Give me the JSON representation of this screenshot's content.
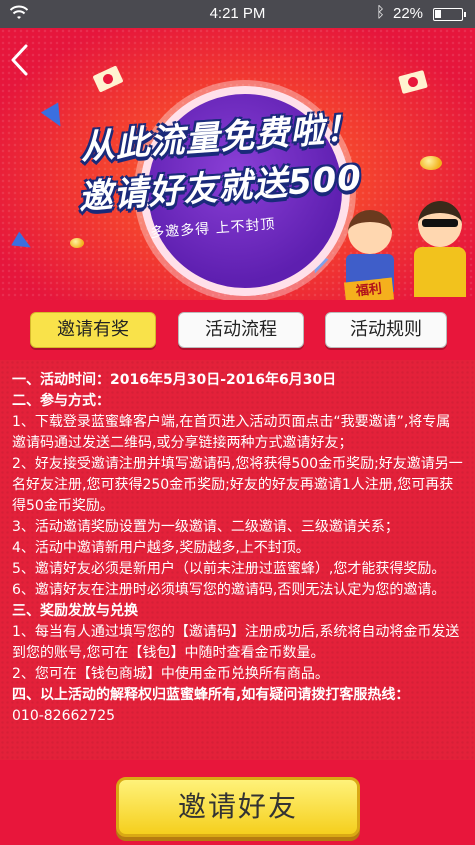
{
  "status_bar": {
    "time": "4:21 PM",
    "battery_text": "22%",
    "battery_level": 0.22,
    "wifi_icon": "wifi-icon",
    "bluetooth_icon": "bluetooth-icon"
  },
  "banner": {
    "back_icon": "chevron-left-icon",
    "headline_line1": "从此流量免费啦！",
    "headline_line2": "邀请好友就送500",
    "tagline": "多邀多得 上不封顶",
    "sign_text": "福利",
    "colors": {
      "background": "#e8163b",
      "circle": "#5e1fb0",
      "text_shadow": "#1a2a7a"
    }
  },
  "tabs": [
    {
      "label": "邀请有奖",
      "active": true
    },
    {
      "label": "活动流程",
      "active": false
    },
    {
      "label": "活动规则",
      "active": false
    }
  ],
  "content": {
    "lines": [
      {
        "text": "一、活动时间：2016年5月30日-2016年6月30日",
        "heading": true
      },
      {
        "text": "二、参与方式：",
        "heading": true
      },
      {
        "text": "1、下载登录蓝蜜蜂客户端,在首页进入活动页面点击“我要邀请”,将专属邀请码通过发送二维码,或分享链接两种方式邀请好友；",
        "heading": false
      },
      {
        "text": "2、好友接受邀请注册并填写邀请码,您将获得500金币奖励;好友邀请另一名好友注册,您可获得250金币奖励;好友的好友再邀请1人注册,您可再获得50金币奖励。",
        "heading": false
      },
      {
        "text": "3、活动邀请奖励设置为一级邀请、二级邀请、三级邀请关系；",
        "heading": false
      },
      {
        "text": "4、活动中邀请新用户越多,奖励越多,上不封顶。",
        "heading": false
      },
      {
        "text": "5、邀请好友必须是新用户（以前未注册过蓝蜜蜂）,您才能获得奖励。",
        "heading": false
      },
      {
        "text": "6、邀请好友在注册时必须填写您的邀请码,否则无法认定为您的邀请。",
        "heading": false
      },
      {
        "text": "三、奖励发放与兑换",
        "heading": true
      },
      {
        "text": "1、每当有人通过填写您的【邀请码】注册成功后,系统将自动将金币发送到您的账号,您可在【钱包】中随时查看金币数量。",
        "heading": false
      },
      {
        "text": "2、您可在【钱包商城】中使用金币兑换所有商品。",
        "heading": false
      },
      {
        "text": "四、以上活动的解释权归蓝蜜蜂所有,如有疑问请拨打客服热线：",
        "heading": true
      },
      {
        "text": "010-82662725",
        "heading": false
      }
    ]
  },
  "cta": {
    "label": "邀请好友"
  }
}
